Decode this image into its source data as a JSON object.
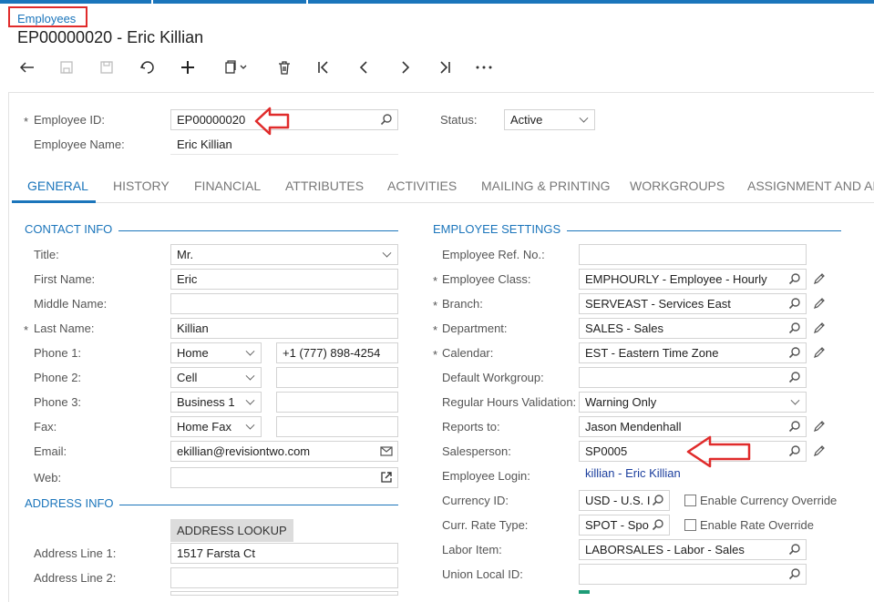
{
  "breadcrumb": "Employees",
  "title": "EP00000020 - Eric Killian",
  "header": {
    "employee_id_label": "Employee ID:",
    "employee_id_value": "EP00000020",
    "employee_name_label": "Employee Name:",
    "employee_name_value": "Eric Killian",
    "status_label": "Status:",
    "status_value": "Active"
  },
  "tabs": [
    "GENERAL",
    "HISTORY",
    "FINANCIAL",
    "ATTRIBUTES",
    "ACTIVITIES",
    "MAILING & PRINTING",
    "WORKGROUPS",
    "ASSIGNMENT AND API"
  ],
  "contact": {
    "section": "CONTACT INFO",
    "title_label": "Title:",
    "title_value": "Mr.",
    "first_label": "First Name:",
    "first_value": "Eric",
    "middle_label": "Middle Name:",
    "middle_value": "",
    "last_label": "Last Name:",
    "last_value": "Killian",
    "phone1_label": "Phone 1:",
    "phone1_type": "Home",
    "phone1_value": "+1 (777) 898-4254",
    "phone2_label": "Phone 2:",
    "phone2_type": "Cell",
    "phone2_value": "",
    "phone3_label": "Phone 3:",
    "phone3_type": "Business 1",
    "phone3_value": "",
    "fax_label": "Fax:",
    "fax_type": "Home Fax",
    "fax_value": "",
    "email_label": "Email:",
    "email_value": "ekillian@revisiontwo.com",
    "web_label": "Web:",
    "web_value": ""
  },
  "address": {
    "section": "ADDRESS INFO",
    "lookup_button": "ADDRESS LOOKUP",
    "line1_label": "Address Line 1:",
    "line1_value": "1517 Farsta Ct",
    "line2_label": "Address Line 2:",
    "line2_value": ""
  },
  "settings": {
    "section": "EMPLOYEE SETTINGS",
    "ref_label": "Employee Ref. No.:",
    "ref_value": "",
    "class_label": "Employee Class:",
    "class_value": "EMPHOURLY - Employee - Hourly",
    "branch_label": "Branch:",
    "branch_value": "SERVEAST - Services East",
    "dept_label": "Department:",
    "dept_value": "SALES - Sales",
    "calendar_label": "Calendar:",
    "calendar_value": "EST - Eastern Time Zone",
    "workgroup_label": "Default Workgroup:",
    "workgroup_value": "",
    "regular_label": "Regular Hours Validation:",
    "regular_value": "Warning Only",
    "reports_label": "Reports to:",
    "reports_value": "Jason Mendenhall",
    "salesperson_label": "Salesperson:",
    "salesperson_value": "SP0005",
    "login_label": "Employee Login:",
    "login_value": "killian - Eric Killian",
    "currency_label": "Currency ID:",
    "currency_value": "USD - U.S. I",
    "currency_override": "Enable Currency Override",
    "rate_label": "Curr. Rate Type:",
    "rate_value": "SPOT - Spo",
    "rate_override": "Enable Rate Override",
    "labor_label": "Labor Item:",
    "labor_value": "LABORSALES - Labor - Sales",
    "union_label": "Union Local ID:",
    "union_value": ""
  },
  "required_mark": "*",
  "colors": {
    "accent": "#1b75bb",
    "annotation": "#e02b2b"
  }
}
